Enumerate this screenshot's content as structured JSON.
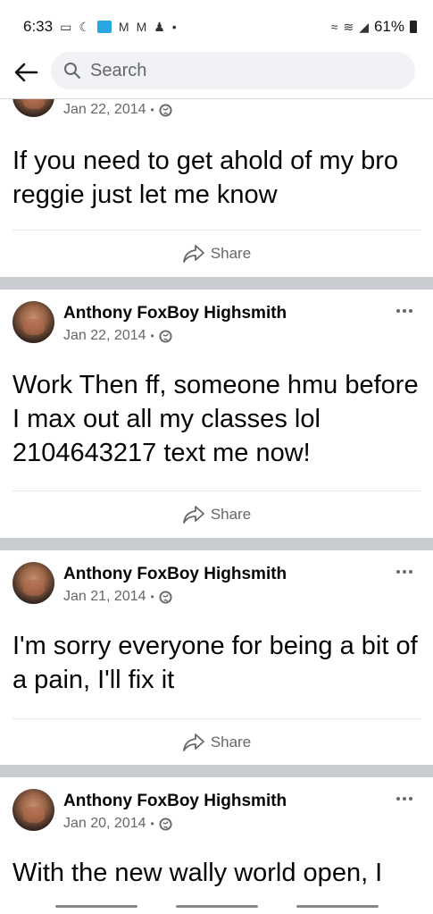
{
  "status": {
    "time": "6:33",
    "battery": "61%"
  },
  "search": {
    "placeholder": "Search"
  },
  "posts": [
    {
      "date": "Jan 22, 2014",
      "text": "If you need to get ahold of my bro reggie just let me know",
      "share": "Share"
    },
    {
      "author": "Anthony FoxBoy Highsmith",
      "date": "Jan 22, 2014",
      "text": "Work Then ff, someone hmu before I max out all my classes lol 2104643217 text me now!",
      "share": "Share"
    },
    {
      "author": "Anthony FoxBoy Highsmith",
      "date": "Jan 21, 2014",
      "text": "I'm sorry everyone for being a bit of a pain, I'll fix it",
      "share": "Share"
    },
    {
      "author": "Anthony FoxBoy Highsmith",
      "date": "Jan 20, 2014",
      "text": "With the new wally world open, I"
    }
  ],
  "icons": {
    "back": "arrow-left-icon",
    "search": "search-icon",
    "globe": "globe-icon",
    "share": "share-icon",
    "more": "more-options-icon"
  },
  "colors": {
    "separator": "#c9ccd1",
    "secondary_text": "#65676b",
    "search_bg": "#f0f2f5"
  }
}
